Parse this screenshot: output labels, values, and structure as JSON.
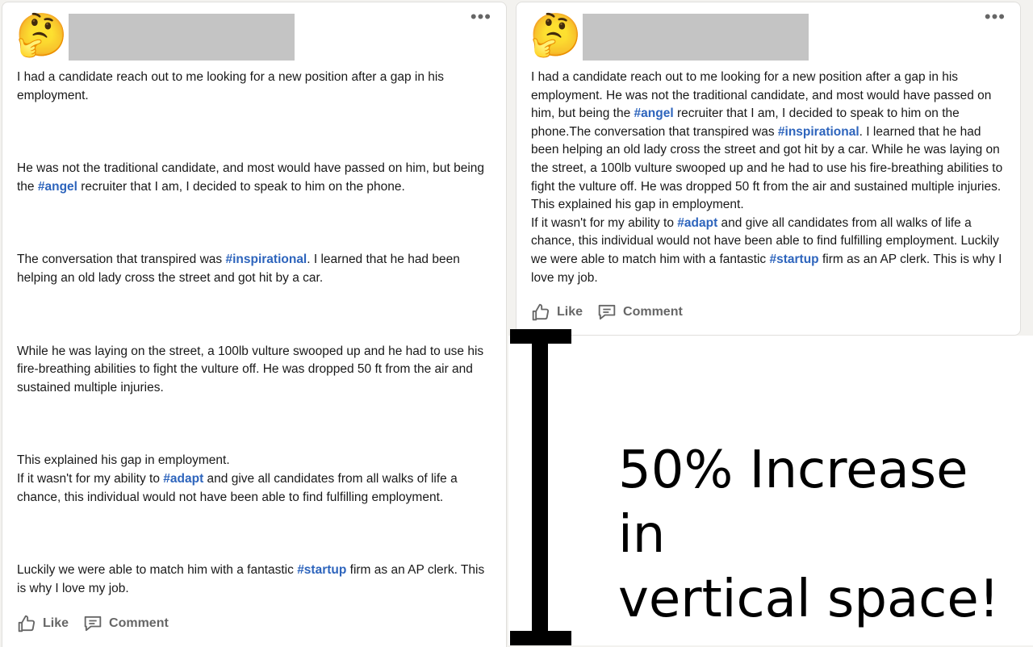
{
  "left_post": {
    "avatar_emoji": "🤔",
    "more_label": "•••",
    "paragraphs": [
      [
        {
          "t": "I had a candidate reach out to me looking for a new position after a gap in his employment."
        }
      ],
      [
        {
          "t": "He was not the traditional candidate, and most would have passed on him, but being the "
        },
        {
          "h": "#angel"
        },
        {
          "t": " recruiter that I am, I decided to speak to him on the phone."
        }
      ],
      [
        {
          "t": "The conversation that transpired was "
        },
        {
          "h": "#inspirational"
        },
        {
          "t": ". I learned that he had been helping an old lady cross the street and got hit by a car."
        }
      ],
      [
        {
          "t": "While he was laying on the street, a 100lb vulture swooped up and he had to use his fire-breathing abilities to fight the vulture off. He was dropped 50 ft from the air and sustained multiple injuries."
        }
      ],
      [
        {
          "t": "This explained his gap in employment."
        },
        {
          "br": true
        },
        {
          "t": "If it wasn't for my ability to "
        },
        {
          "h": "#adapt"
        },
        {
          "t": " and give all candidates from all walks of life a chance, this individual would not have been able to find fulfilling employment."
        }
      ],
      [
        {
          "t": "Luckily we were able to match him with a fantastic "
        },
        {
          "h": "#startup"
        },
        {
          "t": " firm as an AP clerk. This is why I love my job."
        }
      ]
    ],
    "like_label": "Like",
    "comment_label": "Comment"
  },
  "right_post": {
    "avatar_emoji": "🤔",
    "more_label": "•••",
    "paragraphs": [
      [
        {
          "t": "I had a candidate reach out to me looking for a new position after a gap in his employment. He was not the traditional candidate, and most would have passed on him, but being the "
        },
        {
          "h": "#angel"
        },
        {
          "t": " recruiter that I am, I decided to speak to him on the phone.The conversation that transpired was "
        },
        {
          "h": "#inspirational"
        },
        {
          "t": ". I learned that he had been helping an old lady cross the street and got hit by a car. While he was laying on the street, a 100lb vulture swooped up and he had to use his fire-breathing abilities to fight the vulture off. He was dropped 50 ft from the air and sustained multiple injuries. This explained his gap in employment."
        },
        {
          "br": true
        },
        {
          "t": "If it wasn't for my ability to "
        },
        {
          "h": "#adapt"
        },
        {
          "t": " and give all candidates from all walks of life a chance, this individual would not have been able to find fulfilling employment. Luckily we were able to match him with a fantastic "
        },
        {
          "h": "#startup"
        },
        {
          "t": " firm as an AP clerk. This is why I love my job."
        }
      ]
    ],
    "like_label": "Like",
    "comment_label": "Comment"
  },
  "callout": {
    "line1": "50% Increase in",
    "line2": "vertical space!"
  },
  "colors": {
    "hashtag": "#2d64bc",
    "action_gray": "#666666",
    "redacted_box": "#c4c4c4"
  }
}
